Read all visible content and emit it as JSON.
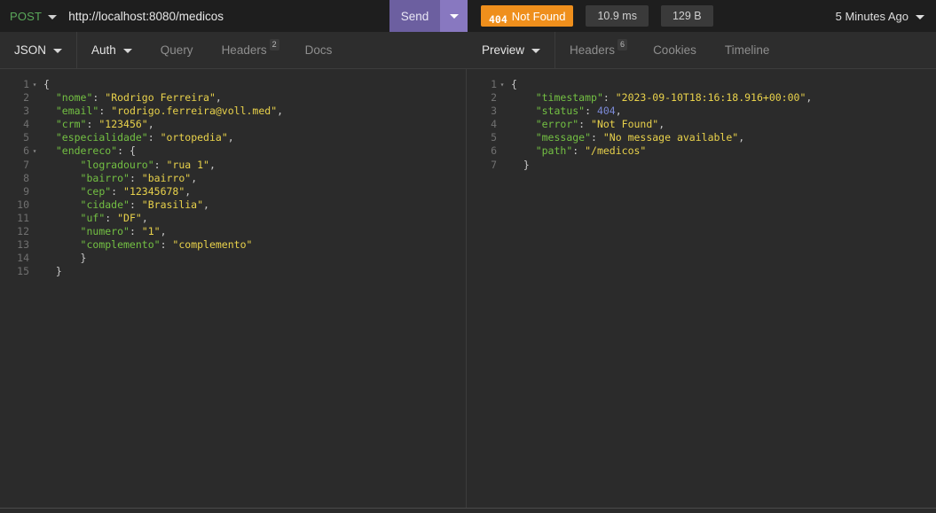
{
  "request": {
    "method": "POST",
    "url": "http://localhost:8080/medicos",
    "send_label": "Send",
    "send_dropdown_icon": "chevron-down-icon",
    "method_dropdown_icon": "chevron-down-icon"
  },
  "response": {
    "status_code": "404",
    "status_text": "Not Found",
    "time": "10.9 ms",
    "size": "129 B",
    "time_ago": "5 Minutes Ago",
    "time_ago_icon": "chevron-down-icon",
    "status_color": "#ef8f1c"
  },
  "request_tabs": {
    "body_type": "JSON",
    "body_type_icon": "chevron-down-icon",
    "items": [
      {
        "label": "Auth",
        "badge": "",
        "icon": "chevron-down-icon",
        "active": true
      },
      {
        "label": "Query",
        "badge": "",
        "icon": "",
        "active": false
      },
      {
        "label": "Headers",
        "badge": "2",
        "icon": "",
        "active": false
      },
      {
        "label": "Docs",
        "badge": "",
        "icon": "",
        "active": false
      }
    ]
  },
  "response_tabs": {
    "items": [
      {
        "label": "Preview",
        "badge": "",
        "icon": "chevron-down-icon",
        "active": true
      },
      {
        "label": "Headers",
        "badge": "6",
        "icon": "",
        "active": false
      },
      {
        "label": "Cookies",
        "badge": "",
        "icon": "",
        "active": false
      },
      {
        "label": "Timeline",
        "badge": "",
        "icon": "",
        "active": false
      }
    ]
  },
  "request_body": {
    "lines": [
      {
        "n": "1",
        "fold": "▾",
        "tokens": [
          {
            "t": "punct",
            "v": "{"
          }
        ]
      },
      {
        "n": "2",
        "fold": "",
        "tokens": [
          {
            "t": "plain",
            "v": "  "
          },
          {
            "t": "key",
            "v": "\"nome\""
          },
          {
            "t": "punct",
            "v": ": "
          },
          {
            "t": "str",
            "v": "\"Rodrigo Ferreira\""
          },
          {
            "t": "punct",
            "v": ","
          }
        ]
      },
      {
        "n": "3",
        "fold": "",
        "tokens": [
          {
            "t": "plain",
            "v": "  "
          },
          {
            "t": "key",
            "v": "\"email\""
          },
          {
            "t": "punct",
            "v": ": "
          },
          {
            "t": "str",
            "v": "\"rodrigo.ferreira@voll.med\""
          },
          {
            "t": "punct",
            "v": ","
          }
        ]
      },
      {
        "n": "4",
        "fold": "",
        "tokens": [
          {
            "t": "plain",
            "v": "  "
          },
          {
            "t": "key",
            "v": "\"crm\""
          },
          {
            "t": "punct",
            "v": ": "
          },
          {
            "t": "str",
            "v": "\"123456\""
          },
          {
            "t": "punct",
            "v": ","
          }
        ]
      },
      {
        "n": "5",
        "fold": "",
        "tokens": [
          {
            "t": "plain",
            "v": "  "
          },
          {
            "t": "key",
            "v": "\"especialidade\""
          },
          {
            "t": "punct",
            "v": ": "
          },
          {
            "t": "str",
            "v": "\"ortopedia\""
          },
          {
            "t": "punct",
            "v": ","
          }
        ]
      },
      {
        "n": "6",
        "fold": "▾",
        "tokens": [
          {
            "t": "plain",
            "v": "  "
          },
          {
            "t": "key",
            "v": "\"endereco\""
          },
          {
            "t": "punct",
            "v": ": {"
          }
        ]
      },
      {
        "n": "7",
        "fold": "",
        "tokens": [
          {
            "t": "plain",
            "v": "      "
          },
          {
            "t": "key",
            "v": "\"logradouro\""
          },
          {
            "t": "punct",
            "v": ": "
          },
          {
            "t": "str",
            "v": "\"rua 1\""
          },
          {
            "t": "punct",
            "v": ","
          }
        ]
      },
      {
        "n": "8",
        "fold": "",
        "tokens": [
          {
            "t": "plain",
            "v": "      "
          },
          {
            "t": "key",
            "v": "\"bairro\""
          },
          {
            "t": "punct",
            "v": ": "
          },
          {
            "t": "str",
            "v": "\"bairro\""
          },
          {
            "t": "punct",
            "v": ","
          }
        ]
      },
      {
        "n": "9",
        "fold": "",
        "tokens": [
          {
            "t": "plain",
            "v": "      "
          },
          {
            "t": "key",
            "v": "\"cep\""
          },
          {
            "t": "punct",
            "v": ": "
          },
          {
            "t": "str",
            "v": "\"12345678\""
          },
          {
            "t": "punct",
            "v": ","
          }
        ]
      },
      {
        "n": "10",
        "fold": "",
        "tokens": [
          {
            "t": "plain",
            "v": "      "
          },
          {
            "t": "key",
            "v": "\"cidade\""
          },
          {
            "t": "punct",
            "v": ": "
          },
          {
            "t": "str",
            "v": "\"Brasilia\""
          },
          {
            "t": "punct",
            "v": ","
          }
        ]
      },
      {
        "n": "11",
        "fold": "",
        "tokens": [
          {
            "t": "plain",
            "v": "      "
          },
          {
            "t": "key",
            "v": "\"uf\""
          },
          {
            "t": "punct",
            "v": ": "
          },
          {
            "t": "str",
            "v": "\"DF\""
          },
          {
            "t": "punct",
            "v": ","
          }
        ]
      },
      {
        "n": "12",
        "fold": "",
        "tokens": [
          {
            "t": "plain",
            "v": "      "
          },
          {
            "t": "key",
            "v": "\"numero\""
          },
          {
            "t": "punct",
            "v": ": "
          },
          {
            "t": "str",
            "v": "\"1\""
          },
          {
            "t": "punct",
            "v": ","
          }
        ]
      },
      {
        "n": "13",
        "fold": "",
        "tokens": [
          {
            "t": "plain",
            "v": "      "
          },
          {
            "t": "key",
            "v": "\"complemento\""
          },
          {
            "t": "punct",
            "v": ": "
          },
          {
            "t": "str",
            "v": "\"complemento\""
          }
        ]
      },
      {
        "n": "14",
        "fold": "",
        "tokens": [
          {
            "t": "plain",
            "v": "      "
          },
          {
            "t": "punct",
            "v": "}"
          }
        ]
      },
      {
        "n": "15",
        "fold": "",
        "tokens": [
          {
            "t": "plain",
            "v": "  "
          },
          {
            "t": "punct",
            "v": "}"
          }
        ]
      }
    ]
  },
  "response_body": {
    "lines": [
      {
        "n": "1",
        "fold": "▾",
        "tokens": [
          {
            "t": "punct",
            "v": "{"
          }
        ]
      },
      {
        "n": "2",
        "fold": "",
        "tokens": [
          {
            "t": "plain",
            "v": "    "
          },
          {
            "t": "key",
            "v": "\"timestamp\""
          },
          {
            "t": "punct",
            "v": ": "
          },
          {
            "t": "str",
            "v": "\"2023-09-10T18:16:18.916+00:00\""
          },
          {
            "t": "punct",
            "v": ","
          }
        ]
      },
      {
        "n": "3",
        "fold": "",
        "tokens": [
          {
            "t": "plain",
            "v": "    "
          },
          {
            "t": "key",
            "v": "\"status\""
          },
          {
            "t": "punct",
            "v": ": "
          },
          {
            "t": "num",
            "v": "404"
          },
          {
            "t": "punct",
            "v": ","
          }
        ]
      },
      {
        "n": "4",
        "fold": "",
        "tokens": [
          {
            "t": "plain",
            "v": "    "
          },
          {
            "t": "key",
            "v": "\"error\""
          },
          {
            "t": "punct",
            "v": ": "
          },
          {
            "t": "str",
            "v": "\"Not Found\""
          },
          {
            "t": "punct",
            "v": ","
          }
        ]
      },
      {
        "n": "5",
        "fold": "",
        "tokens": [
          {
            "t": "plain",
            "v": "    "
          },
          {
            "t": "key",
            "v": "\"message\""
          },
          {
            "t": "punct",
            "v": ": "
          },
          {
            "t": "str",
            "v": "\"No message available\""
          },
          {
            "t": "punct",
            "v": ","
          }
        ]
      },
      {
        "n": "6",
        "fold": "",
        "tokens": [
          {
            "t": "plain",
            "v": "    "
          },
          {
            "t": "key",
            "v": "\"path\""
          },
          {
            "t": "punct",
            "v": ": "
          },
          {
            "t": "str",
            "v": "\"/medicos\""
          }
        ]
      },
      {
        "n": "7",
        "fold": "",
        "tokens": [
          {
            "t": "plain",
            "v": "  "
          },
          {
            "t": "punct",
            "v": "}"
          }
        ]
      }
    ]
  }
}
